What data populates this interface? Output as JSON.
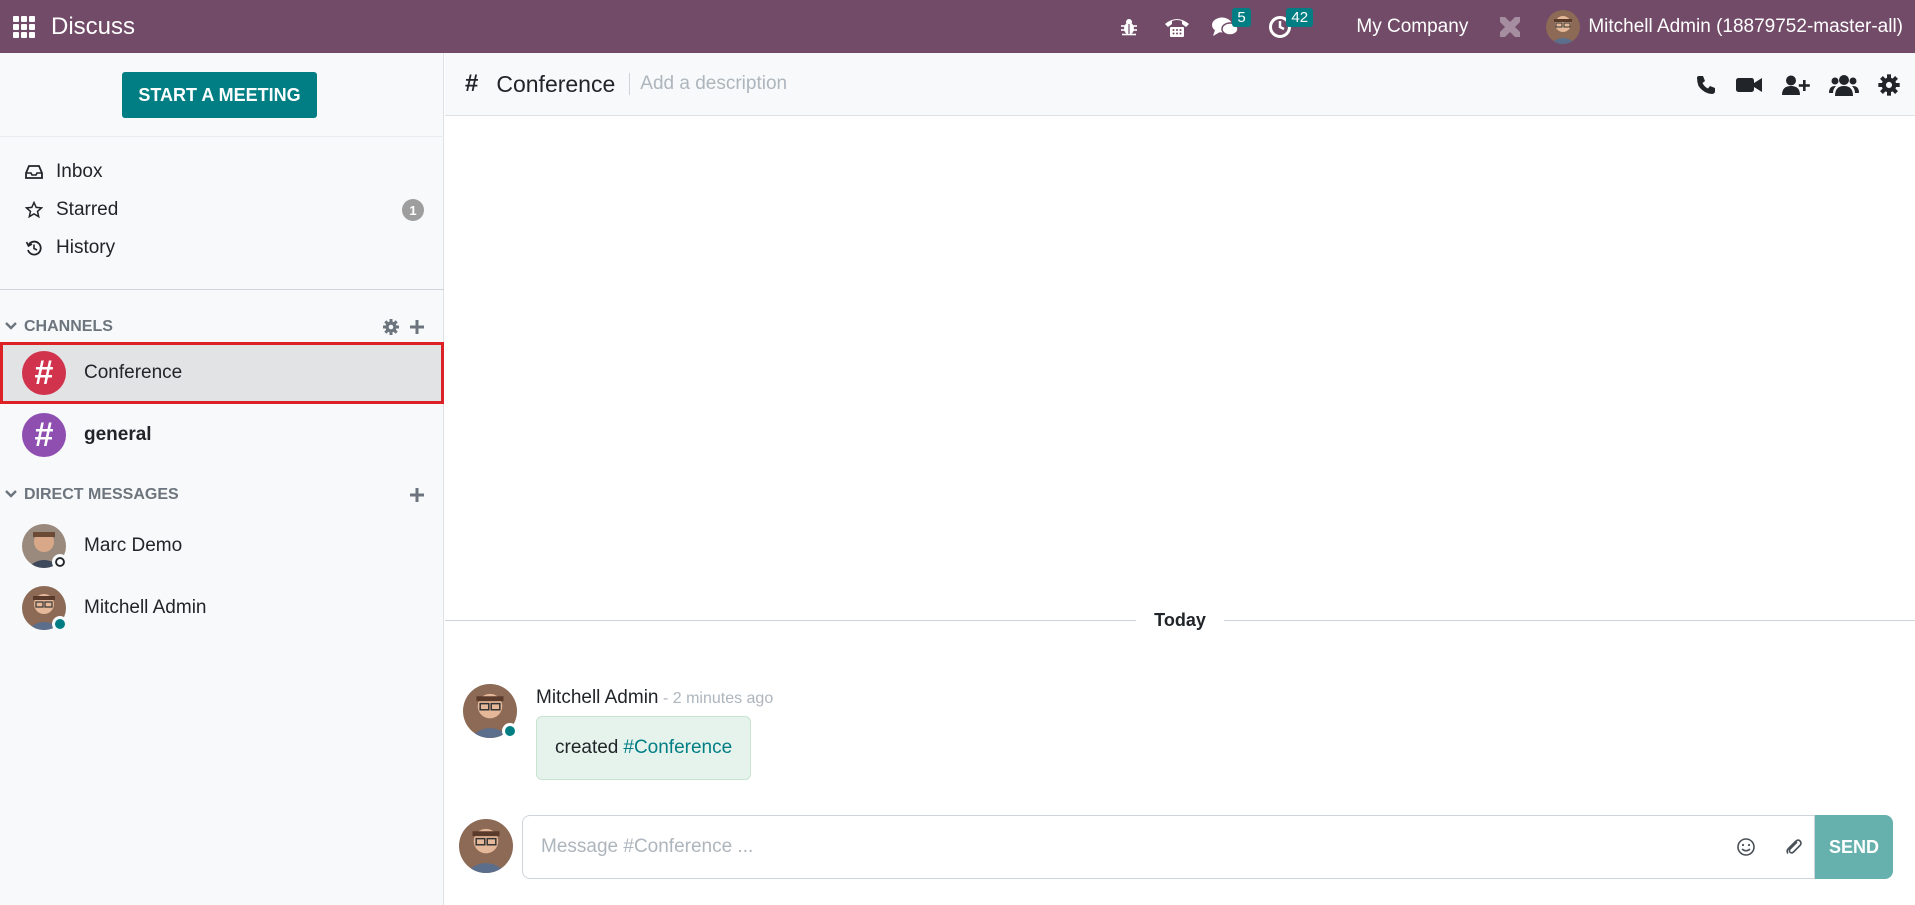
{
  "navbar": {
    "app_name": "Discuss",
    "messages_badge": "5",
    "activities_badge": "42",
    "company": "My Company",
    "user_name": "Mitchell Admin (18879752-master-all)",
    "color": "#714b67"
  },
  "sidebar": {
    "start_meeting_label": "START A MEETING",
    "mailboxes": [
      {
        "label": "Inbox",
        "icon": "inbox-icon"
      },
      {
        "label": "Starred",
        "icon": "star-icon",
        "counter": "1"
      },
      {
        "label": "History",
        "icon": "history-icon"
      }
    ],
    "channels_header": "CHANNELS",
    "channels": [
      {
        "name": "Conference",
        "color": "#d2334c",
        "active": true
      },
      {
        "name": "general",
        "color": "#8f4fb0",
        "unread": true
      }
    ],
    "dm_header": "DIRECT MESSAGES",
    "direct_messages": [
      {
        "name": "Marc Demo",
        "status": "away"
      },
      {
        "name": "Mitchell Admin",
        "status": "online"
      }
    ]
  },
  "thread": {
    "channel_name": "Conference",
    "description_placeholder": "Add a description",
    "date_separator": "Today",
    "messages": [
      {
        "author": "Mitchell Admin",
        "date": " - 2 minutes ago",
        "body_text": "created",
        "body_link": "#Conference"
      }
    ]
  },
  "composer": {
    "placeholder": "Message #Conference ...",
    "send_label": "SEND"
  },
  "colors": {
    "primary": "#017e84",
    "send_disabled": "#66b1ae",
    "highlight_border": "#dc2127"
  }
}
